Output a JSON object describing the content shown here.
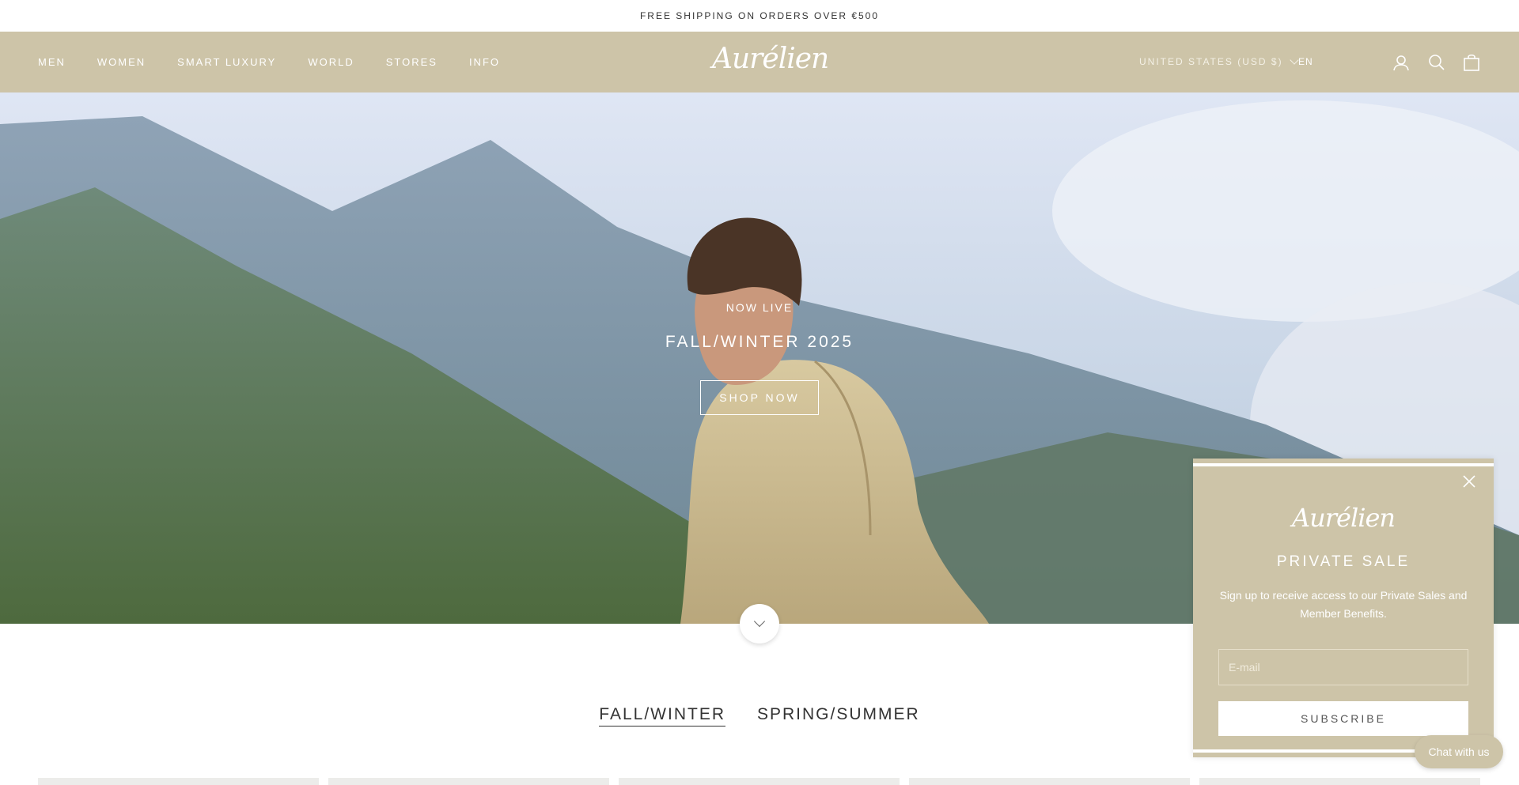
{
  "announcement": "FREE SHIPPING ON ORDERS OVER €500",
  "header": {
    "nav": [
      "MEN",
      "WOMEN",
      "SMART LUXURY",
      "WORLD",
      "STORES",
      "INFO"
    ],
    "logo": "Aurélien",
    "country": "UNITED STATES (USD $)",
    "language": "EN",
    "icons": [
      "account-icon",
      "search-icon",
      "cart-icon"
    ]
  },
  "hero": {
    "eyebrow": "NOW LIVE",
    "title": "FALL/WINTER 2025",
    "cta": "SHOP NOW"
  },
  "collections": {
    "tabs": [
      "FALL/WINTER",
      "SPRING/SUMMER"
    ],
    "active": "FALL/WINTER"
  },
  "popup": {
    "logo": "Aurélien",
    "title": "PRIVATE SALE",
    "text": "Sign up to receive access to our Private Sales and Member Benefits.",
    "email_placeholder": "E-mail",
    "subscribe": "SUBSCRIBE"
  },
  "chat": "Chat with us",
  "colors": {
    "brand_sand": "#cdc4a8",
    "white": "#ffffff",
    "text_dark": "#333333"
  }
}
